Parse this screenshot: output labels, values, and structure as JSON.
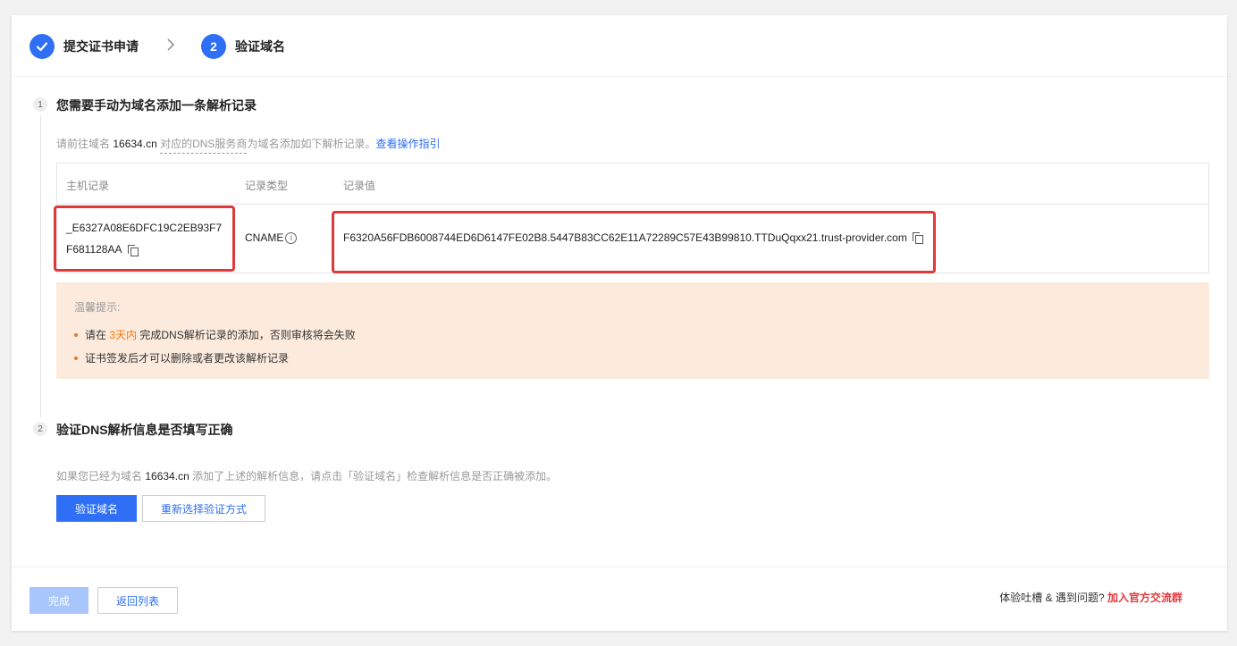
{
  "stepper": {
    "step1": {
      "label": "提交证书申请"
    },
    "step2": {
      "number": "2",
      "label": "验证域名"
    }
  },
  "section1": {
    "number": "1",
    "title": "您需要手动为域名添加一条解析记录",
    "hint_prefix": "请前往域名",
    "domain": "16634.cn",
    "hint_dashed": "对应的DNS服务商",
    "hint_suffix": "为域名添加如下解析记录。",
    "guide_link": "查看操作指引"
  },
  "table": {
    "headers": [
      "主机记录",
      "记录类型",
      "记录值"
    ],
    "row": {
      "host": "_E6327A08E6DFC19C2EB93F7F681128AA",
      "type": "CNAME",
      "value": "F6320A56FDB6008744ED6D6147FE02B8.5447B83CC62E11A72289C57E43B99810.TTDuQqxx21.trust-provider.com"
    }
  },
  "tips": {
    "title": "温馨提示:",
    "item1_before": "请在",
    "item1_accent": "3天内",
    "item1_after": "完成DNS解析记录的添加，否则审核将会失败",
    "item2": "证书签发后才可以删除或者更改该解析记录"
  },
  "section2": {
    "number": "2",
    "title": "验证DNS解析信息是否填写正确",
    "desc_prefix": "如果您已经为域名",
    "domain": "16634.cn",
    "desc_suffix": "添加了上述的解析信息，请点击「验证域名」检查解析信息是否正确被添加。",
    "verify_button": "验证域名",
    "reselect_button": "重新选择验证方式"
  },
  "footer": {
    "finish_button": "完成",
    "back_button": "返回列表",
    "feedback_text": "体验吐槽 & 遇到问题?",
    "feedback_link": "加入官方交流群"
  },
  "colors": {
    "primary": "#2e6ff6",
    "highlight_box": "#e0393c",
    "tips_bg": "#fcebdd",
    "accent_orange": "#ff7200"
  }
}
